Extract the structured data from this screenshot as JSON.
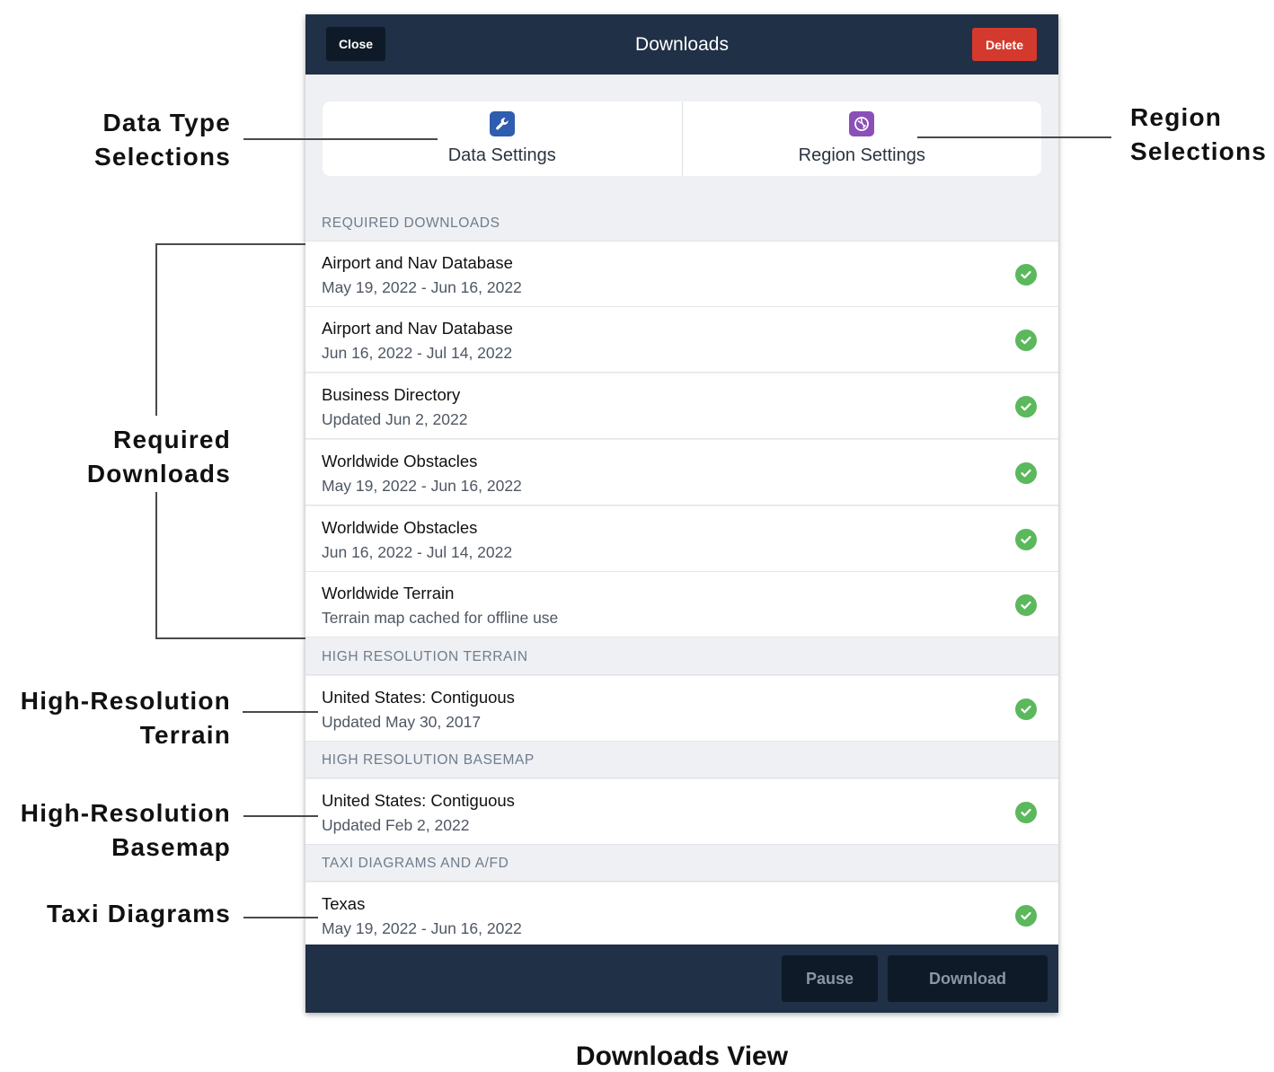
{
  "header": {
    "close_label": "Close",
    "title": "Downloads",
    "delete_label": "Delete"
  },
  "segments": [
    {
      "label": "Data Settings",
      "icon": "wrench-icon",
      "color": "#2f5db0"
    },
    {
      "label": "Region Settings",
      "icon": "globe-icon",
      "color": "#8b4fb8"
    }
  ],
  "sections": {
    "required": {
      "header": "REQUIRED DOWNLOADS",
      "items": [
        {
          "title": "Airport and Nav Database",
          "subtitle": "May 19, 2022 - Jun 16, 2022"
        },
        {
          "title": "Airport and Nav Database",
          "subtitle": "Jun 16, 2022 - Jul 14, 2022"
        },
        {
          "title": "Business Directory",
          "subtitle": "Updated Jun 2, 2022"
        },
        {
          "title": "Worldwide Obstacles",
          "subtitle": "May 19, 2022 - Jun 16, 2022"
        },
        {
          "title": "Worldwide Obstacles",
          "subtitle": "Jun 16, 2022 - Jul 14, 2022"
        },
        {
          "title": "Worldwide Terrain",
          "subtitle": "Terrain map cached for offline use"
        }
      ]
    },
    "terrain": {
      "header": "HIGH RESOLUTION TERRAIN",
      "items": [
        {
          "title": "United States: Contiguous",
          "subtitle": "Updated May 30, 2017"
        }
      ]
    },
    "basemap": {
      "header": "HIGH RESOLUTION BASEMAP",
      "items": [
        {
          "title": "United States: Contiguous",
          "subtitle": "Updated Feb 2, 2022"
        }
      ]
    },
    "taxi": {
      "header": "TAXI DIAGRAMS AND A/FD",
      "items": [
        {
          "title": "Texas",
          "subtitle": "May 19, 2022 - Jun 16, 2022"
        }
      ]
    }
  },
  "footer": {
    "pause_label": "Pause",
    "download_label": "Download"
  },
  "callouts": {
    "data_type": [
      "Data Type",
      "Selections"
    ],
    "region": [
      "Region",
      "Selections"
    ],
    "required": [
      "Required",
      "Downloads"
    ],
    "hr_terrain": [
      "High-Resolution",
      "Terrain"
    ],
    "hr_basemap": [
      "High-Resolution",
      "Basemap"
    ],
    "taxi": [
      "Taxi Diagrams"
    ]
  },
  "caption": "Downloads View",
  "colors": {
    "bar": "#1f3047",
    "delete": "#d4392d",
    "check": "#5cb85c"
  }
}
